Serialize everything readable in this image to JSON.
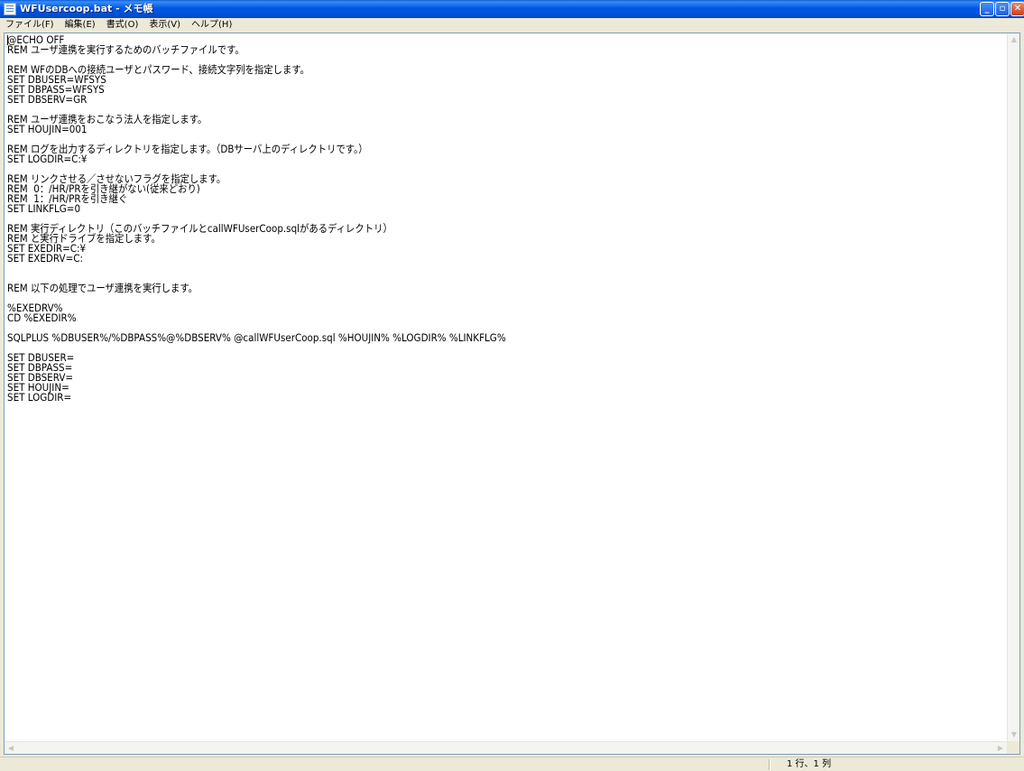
{
  "window": {
    "title": "WFUsercoop.bat - メモ帳",
    "minimize_glyph": "_",
    "maximize_glyph": "▫",
    "close_glyph": "✕"
  },
  "menu": [
    {
      "label": "ファイル(F)"
    },
    {
      "label": "編集(E)"
    },
    {
      "label": "書式(O)"
    },
    {
      "label": "表示(V)"
    },
    {
      "label": "ヘルプ(H)"
    }
  ],
  "editor": {
    "content": "@ECHO OFF\nREM ユーザ連携を実行するためのバッチファイルです。\n\nREM WFのDBへの接続ユーザとパスワード、接続文字列を指定します。\nSET DBUSER=WFSYS\nSET DBPASS=WFSYS\nSET DBSERV=GR\n\nREM ユーザ連携をおこなう法人を指定します。\nSET HOUJIN=001\n\nREM ログを出力するディレクトリを指定します。（DBサーバ上のディレクトリです。）\nSET LOGDIR=C:¥\n\nREM リンクさせる／させないフラグを指定します。\nREM  0：/HR/PRを引き継がない(従来どおり)\nREM  1：/HR/PRを引き継ぐ\nSET LINKFLG=0\n\nREM 実行ディレクトリ（このバッチファイルとcallWFUserCoop.sqlがあるディレクトリ）\nREM と実行ドライブを指定します。\nSET EXEDIR=C:¥\nSET EXEDRV=C:\n\n\nREM 以下の処理でユーザ連携を実行します。\n\n%EXEDRV%\nCD %EXEDIR%\n\nSQLPLUS %DBUSER%/%DBPASS%@%DBSERV% @callWFUserCoop.sql %HOUJIN% %LOGDIR% %LINKFLG%\n\nSET DBUSER=\nSET DBPASS=\nSET DBSERV=\nSET HOUJIN=\nSET LOGDIR="
  },
  "status": {
    "position": "1 行、1 列"
  }
}
